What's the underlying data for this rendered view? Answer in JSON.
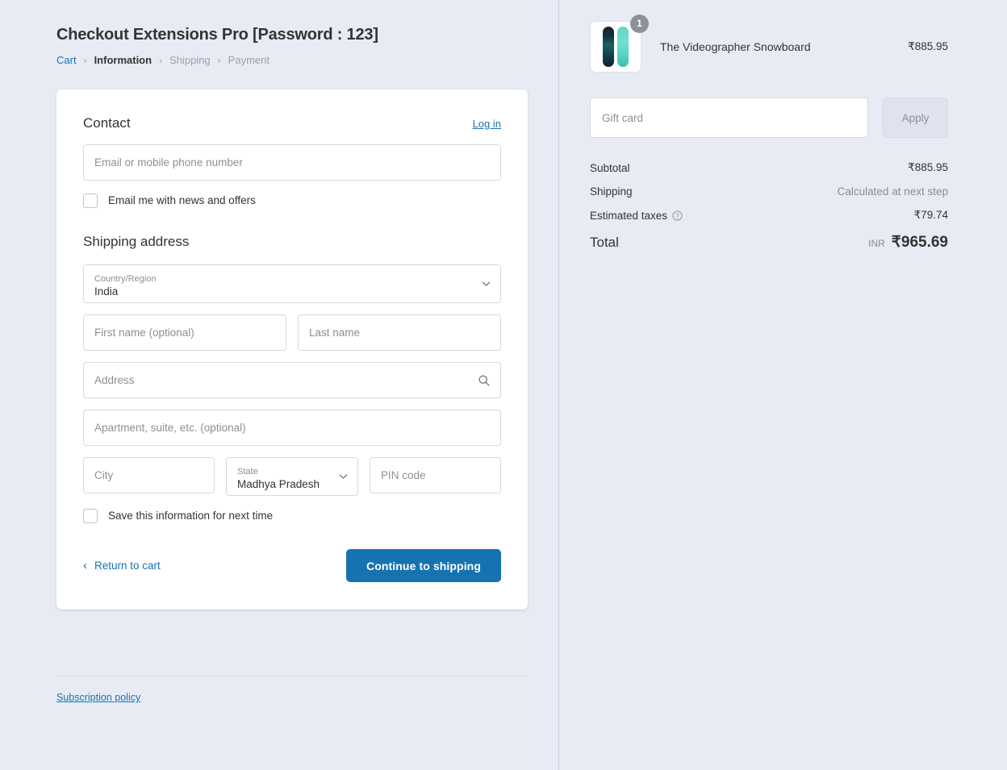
{
  "page": {
    "title": "Checkout Extensions Pro [Password : 123]"
  },
  "breadcrumb": [
    {
      "label": "Cart",
      "state": "link"
    },
    {
      "label": "Information",
      "state": "current"
    },
    {
      "label": "Shipping",
      "state": "muted"
    },
    {
      "label": "Payment",
      "state": "muted"
    }
  ],
  "breadcrumb_separator": "›",
  "contact": {
    "heading": "Contact",
    "login_label": "Log in",
    "email_placeholder": "Email or mobile phone number",
    "newsletter_label": "Email me with news and offers"
  },
  "shipping_address": {
    "heading": "Shipping address",
    "country_label": "Country/Region",
    "country_value": "India",
    "first_name_placeholder": "First name (optional)",
    "last_name_placeholder": "Last name",
    "address_placeholder": "Address",
    "apartment_placeholder": "Apartment, suite, etc. (optional)",
    "city_placeholder": "City",
    "state_label": "State",
    "state_value": "Madhya Pradesh",
    "pin_placeholder": "PIN code",
    "save_info_label": "Save this information for next time"
  },
  "actions": {
    "return_to_cart": "Return to cart",
    "back_arrow": "‹",
    "continue_label": "Continue to shipping"
  },
  "footer": {
    "subscription_policy": "Subscription policy"
  },
  "order_summary": {
    "product": {
      "name": "The Videographer Snowboard",
      "price": "₹885.95",
      "quantity": "1"
    },
    "gift_card_placeholder": "Gift card",
    "apply_label": "Apply",
    "lines": [
      {
        "label": "Subtotal",
        "value": "₹885.95",
        "muted": false
      },
      {
        "label": "Shipping",
        "value": "Calculated at next step",
        "muted": true
      },
      {
        "label": "Estimated taxes",
        "value": "₹79.74",
        "muted": false
      }
    ],
    "total_label": "Total",
    "currency": "INR",
    "total_value": "₹965.69"
  },
  "colors": {
    "accent": "#1773b0",
    "background": "#e8ebf4",
    "card": "#ffffff",
    "badge": "#8e9199"
  }
}
